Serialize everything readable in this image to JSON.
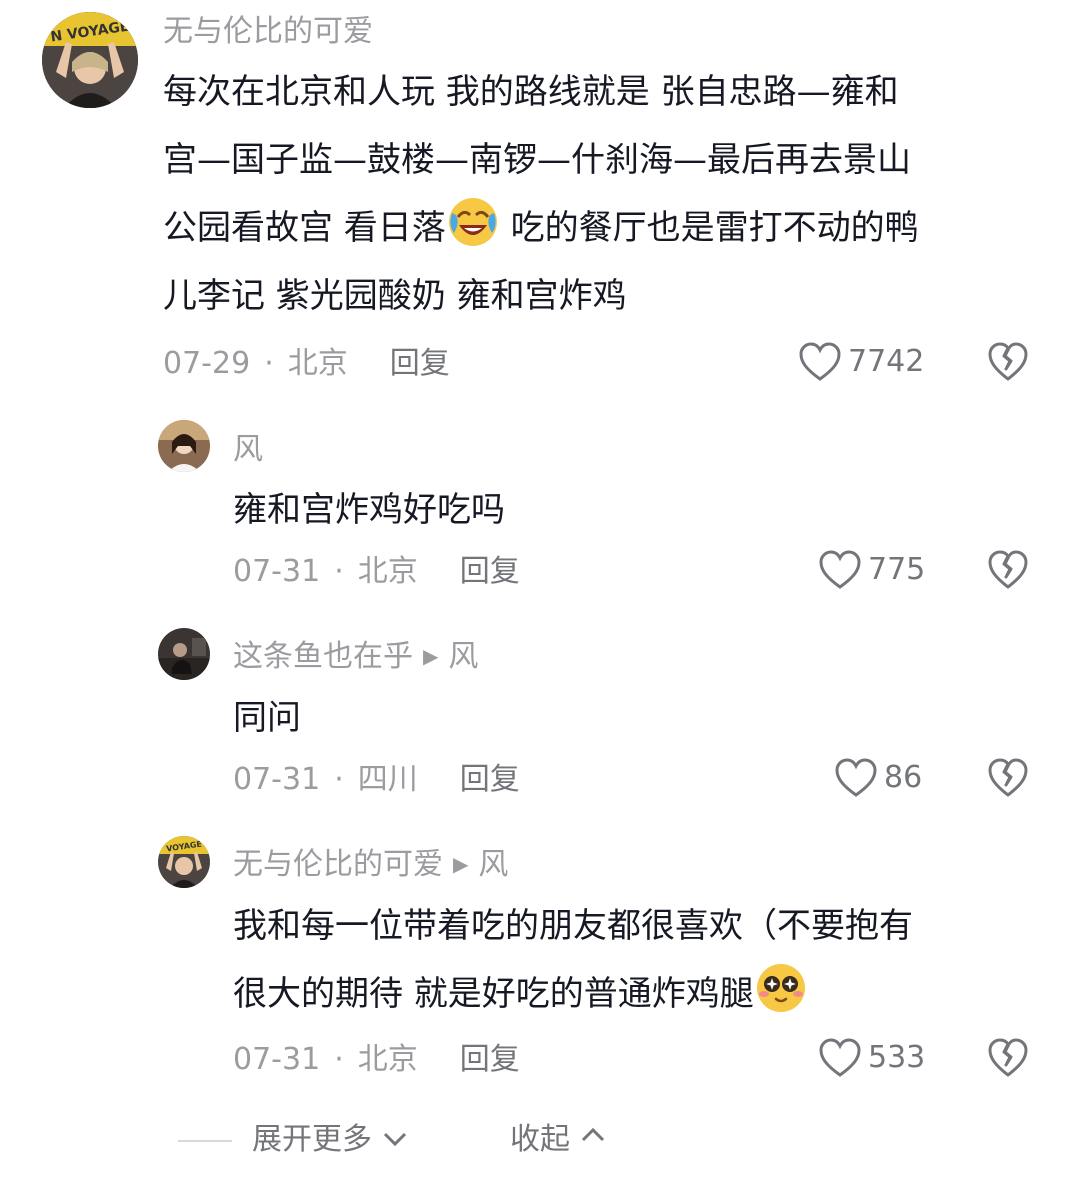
{
  "comments": [
    {
      "username": "无与伦比的可爱",
      "reply_to": "",
      "lines": [
        "每次在北京和人玩 我的路线就是 张自忠路—雍和",
        "宫—国子监—鼓楼—南锣—什刹海—最后再去景山",
        "公园看故宫 看日落",
        " 吃的餐厅也是雷打不动的鸭",
        "儿李记 紫光园酸奶 雍和宫炸鸡"
      ],
      "date": "07-29",
      "location": "北京",
      "reply_label": "回复",
      "likes": "7742"
    },
    {
      "username": "风",
      "reply_to": "",
      "text": "雍和宫炸鸡好吃吗",
      "date": "07-31",
      "location": "北京",
      "reply_label": "回复",
      "likes": "775"
    },
    {
      "username": "这条鱼也在乎",
      "reply_to": "风",
      "text": "同问",
      "date": "07-31",
      "location": "四川",
      "reply_label": "回复",
      "likes": "86"
    },
    {
      "username": "无与伦比的可爱",
      "reply_to": "风",
      "lines": [
        "我和每一位带着吃的朋友都很喜欢（不要抱有",
        "很大的期待 就是好吃的普通炸鸡腿"
      ],
      "date": "07-31",
      "location": "北京",
      "reply_label": "回复",
      "likes": "533"
    }
  ],
  "footer": {
    "expand_label": "展开更多",
    "collapse_label": "收起"
  },
  "icons": {
    "like": "heart-outline-icon",
    "dislike": "broken-heart-icon",
    "expand": "chevron-down-icon",
    "collapse": "chevron-up-icon",
    "emoji_1": "laughing-crying-emoji",
    "emoji_2": "starry-eyes-emoji"
  }
}
